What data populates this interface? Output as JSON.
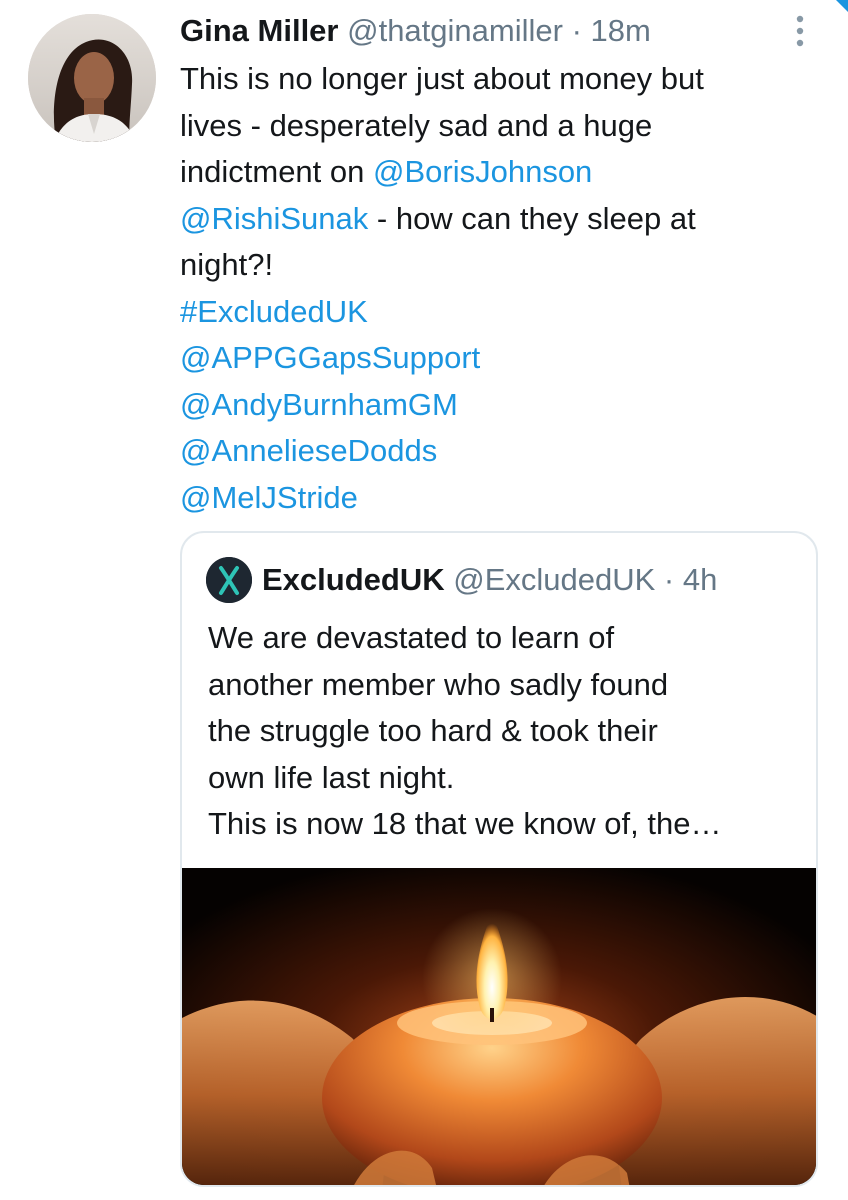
{
  "tweet": {
    "author_name": "Gina Miller",
    "author_handle": "@thatginamiller",
    "separator": "·",
    "time": "18m",
    "text_lines": [
      [
        {
          "t": "This is no longer just about money but",
          "link": false
        }
      ],
      [
        {
          "t": "lives - desperately sad and a huge",
          "link": false
        }
      ],
      [
        {
          "t": "indictment on ",
          "link": false
        },
        {
          "t": "@BorisJohnson",
          "link": true
        }
      ],
      [
        {
          "t": "@RishiSunak",
          "link": true
        },
        {
          "t": " - how can they sleep at",
          "link": false
        }
      ],
      [
        {
          "t": "night?!",
          "link": false
        }
      ],
      [
        {
          "t": "#ExcludedUK",
          "link": true
        }
      ],
      [
        {
          "t": "@APPGGapsSupport",
          "link": true
        }
      ],
      [
        {
          "t": "@AndyBurnhamGM",
          "link": true
        }
      ],
      [
        {
          "t": "@AnnelieseDodds",
          "link": true
        }
      ],
      [
        {
          "t": "@MelJStride",
          "link": true
        }
      ]
    ]
  },
  "quoted_tweet": {
    "author_name": "ExcludedUK",
    "author_handle": "@ExcludedUK",
    "separator": "·",
    "time": "4h",
    "text_lines": [
      "We are devastated to learn of",
      "another member who sadly found",
      "the struggle too hard & took their",
      "own life last night.",
      "This is now 18 that we know of, the…"
    ]
  },
  "icons": {
    "more": "more-vertical-icon",
    "quoted_avatar": "excludeduk-x-logo-icon",
    "media": "candle-in-hands-image"
  },
  "colors": {
    "link": "#1b95e0",
    "text": "#14171a",
    "secondary": "#657786",
    "border": "#e1e8ed",
    "candle_glow": "#e8762a"
  }
}
